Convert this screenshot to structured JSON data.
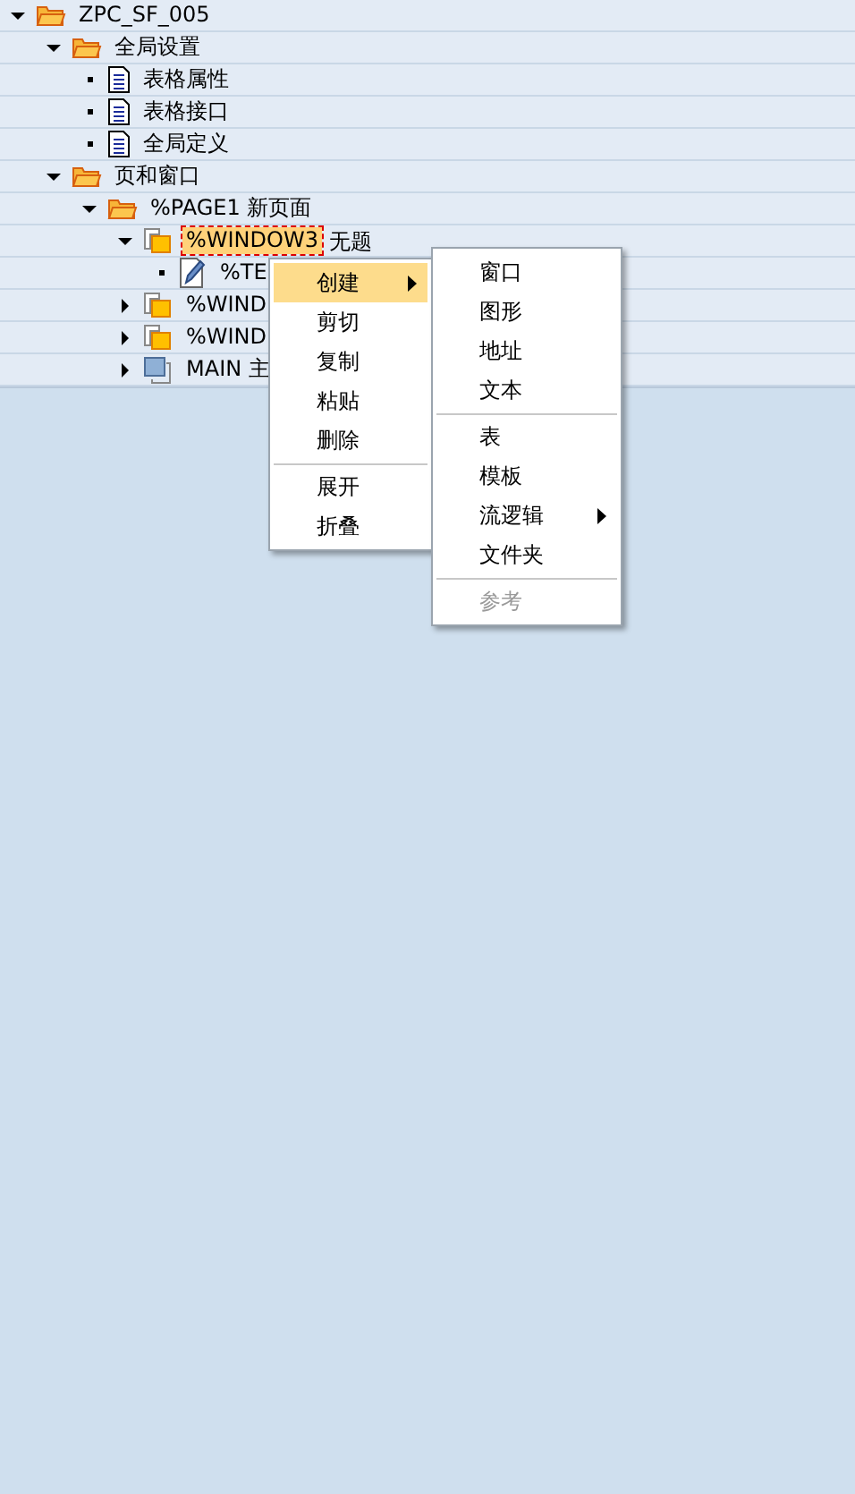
{
  "tree": [
    {
      "label": "ZPC_SF_005",
      "kind": "folder",
      "expanded": true,
      "selected": false,
      "children": [
        {
          "label": "全局设置",
          "kind": "folder",
          "expanded": true,
          "selected": false,
          "children": [
            {
              "label": "表格属性",
              "kind": "document",
              "selected": false
            },
            {
              "label": "表格接口",
              "kind": "document",
              "selected": false
            },
            {
              "label": "全局定义",
              "kind": "document",
              "selected": false
            }
          ]
        },
        {
          "label": "页和窗口",
          "kind": "folder",
          "expanded": true,
          "selected": false,
          "children": [
            {
              "label": "%PAGE1 新页面",
              "kind": "folder",
              "expanded": true,
              "selected": false,
              "children": [
                {
                  "label": "%WINDOW3",
                  "description": "无题",
                  "kind": "window",
                  "expanded": true,
                  "selected": true,
                  "children": [
                    {
                      "label": "%TE",
                      "kind": "text",
                      "selected": false
                    }
                  ]
                },
                {
                  "label": "%WIND",
                  "kind": "window",
                  "expanded": false,
                  "selected": false
                },
                {
                  "label": "%WIND",
                  "kind": "window",
                  "expanded": false,
                  "selected": false
                },
                {
                  "label": "MAIN 主",
                  "kind": "main",
                  "expanded": false,
                  "selected": false
                }
              ]
            }
          ]
        }
      ]
    }
  ],
  "context_menu": {
    "items": [
      {
        "label": "创建",
        "selected": true,
        "submenu": true,
        "separator_before": false
      },
      {
        "label": "剪切",
        "selected": false,
        "submenu": false,
        "separator_before": false
      },
      {
        "label": "复制",
        "selected": false,
        "submenu": false,
        "separator_before": false
      },
      {
        "label": "粘贴",
        "selected": false,
        "submenu": false,
        "separator_before": false
      },
      {
        "label": "删除",
        "selected": false,
        "submenu": false,
        "separator_before": false
      },
      {
        "label": "展开",
        "selected": false,
        "submenu": false,
        "separator_before": true
      },
      {
        "label": "折叠",
        "selected": false,
        "submenu": false,
        "separator_before": false
      }
    ]
  },
  "submenu": {
    "items": [
      {
        "label": "窗口",
        "disabled": false,
        "submenu": false,
        "separator_before": false
      },
      {
        "label": "图形",
        "disabled": false,
        "submenu": false,
        "separator_before": false
      },
      {
        "label": "地址",
        "disabled": false,
        "submenu": false,
        "separator_before": false
      },
      {
        "label": "文本",
        "disabled": false,
        "submenu": false,
        "separator_before": false
      },
      {
        "label": "表",
        "disabled": false,
        "submenu": false,
        "separator_before": true
      },
      {
        "label": "模板",
        "disabled": false,
        "submenu": false,
        "separator_before": false
      },
      {
        "label": "流逻辑",
        "disabled": false,
        "submenu": true,
        "separator_before": false
      },
      {
        "label": "文件夹",
        "disabled": false,
        "submenu": false,
        "separator_before": false
      },
      {
        "label": "参考",
        "disabled": true,
        "submenu": false,
        "separator_before": true
      }
    ]
  }
}
